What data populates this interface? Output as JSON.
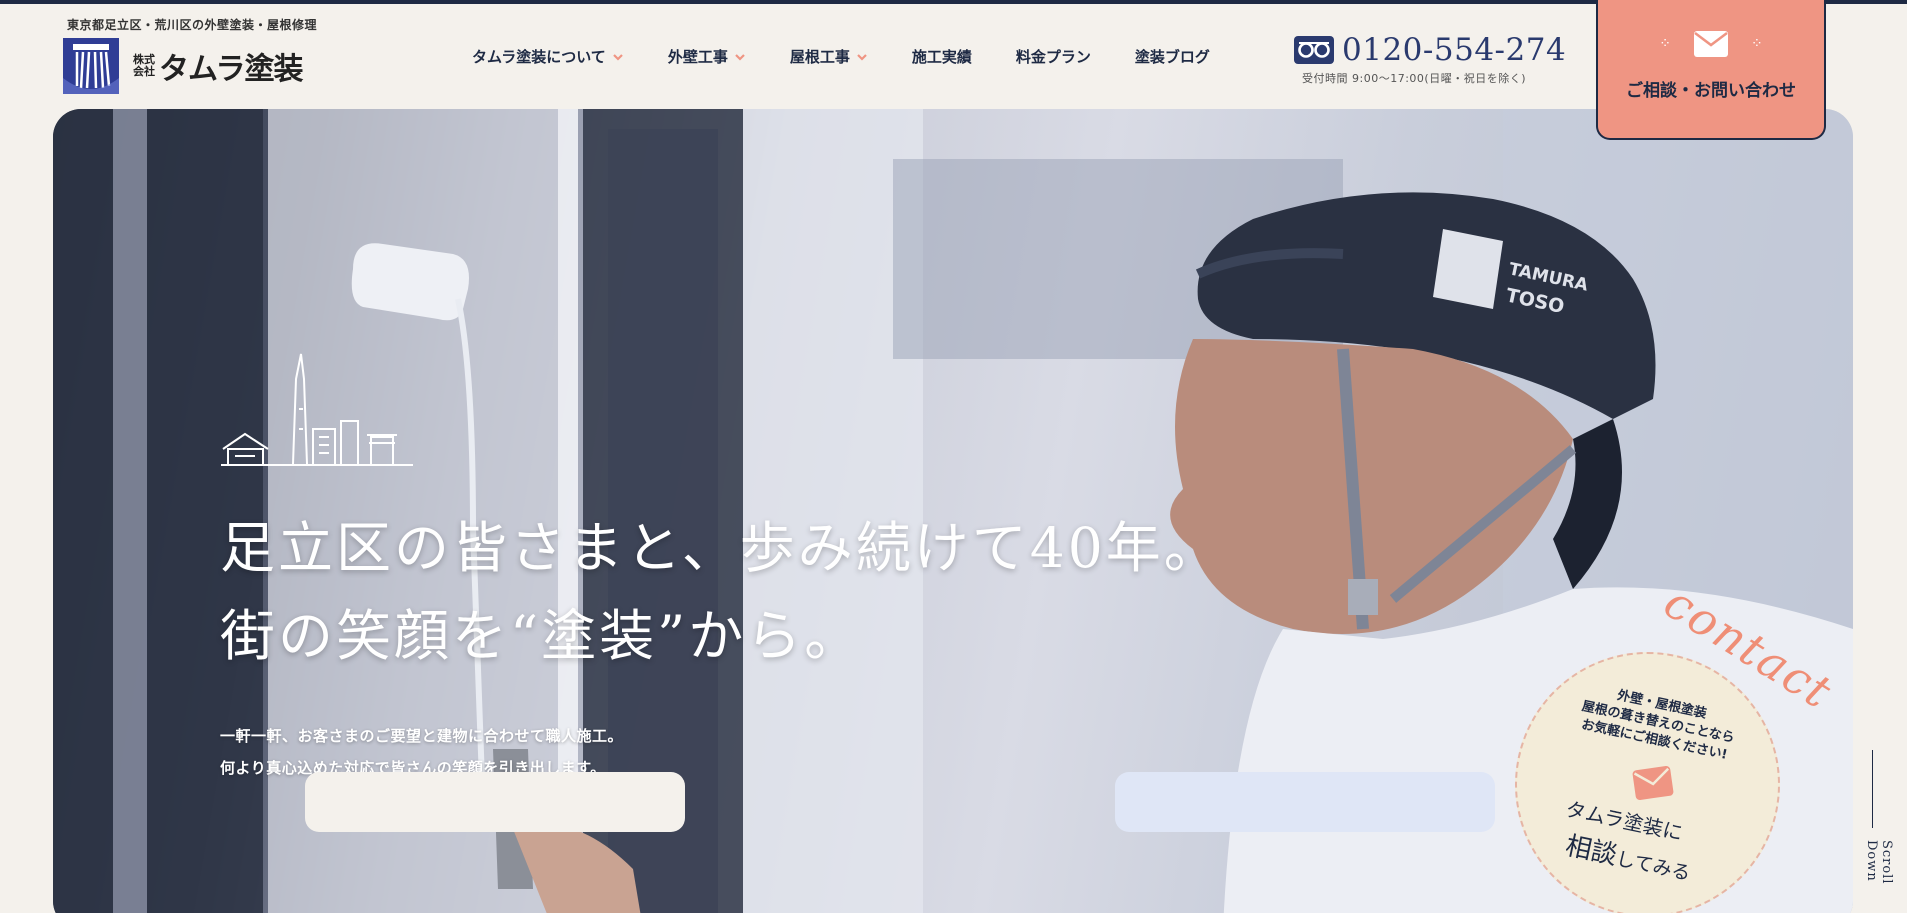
{
  "header": {
    "tagline": "東京都足立区・荒川区の外壁塗装・屋根修理",
    "logo": {
      "kabushiki": "株式会社",
      "name": "タムラ塗装"
    },
    "nav": [
      {
        "label": "タムラ塗装について",
        "has_dropdown": true
      },
      {
        "label": "外壁工事",
        "has_dropdown": true
      },
      {
        "label": "屋根工事",
        "has_dropdown": true
      },
      {
        "label": "施工実績",
        "has_dropdown": false
      },
      {
        "label": "料金プラン",
        "has_dropdown": false
      },
      {
        "label": "塗装ブログ",
        "has_dropdown": false
      }
    ],
    "phone": {
      "number": "0120-554-274",
      "hours": "受付時間 9:00〜17:00(日曜・祝日を除く)"
    },
    "contact_button": "ご相談・お問い合わせ"
  },
  "hero": {
    "headline_line1": "足立区の皆さまと、歩み続けて40年。",
    "headline_line2": "街の笑顔を“塗装”から。",
    "sub_line1": "一軒一軒、お客さまのご要望と建物に合わせて職人施工。",
    "sub_line2": "何より真心込めた対応で皆さんの笑顔を引き出します。",
    "helmet_text1": "TAMURA",
    "helmet_text2": "TOSO"
  },
  "contact_badge": {
    "script": "contact",
    "line1": "外壁・屋根塗装",
    "line2": "屋根の葺き替えのことなら",
    "line3": "お気軽にご相談ください!",
    "cta1": "タムラ塗装に",
    "cta2_big": "相談",
    "cta2_small": "してみる"
  },
  "scroll_indicator": "Scroll Down",
  "colors": {
    "navy": "#1e2a44",
    "accent": "#ef9583",
    "background": "#f4f1ec"
  }
}
